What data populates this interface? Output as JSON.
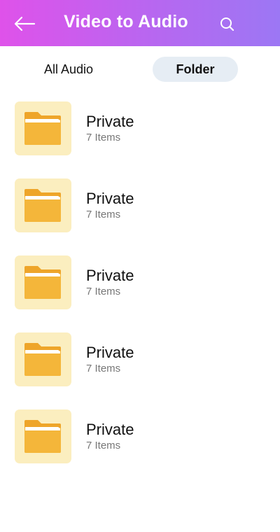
{
  "header": {
    "title": "Video to Audio",
    "back_icon": "arrow-left-icon",
    "search_icon": "search-icon",
    "gradient_start": "#df52ea",
    "gradient_end": "#9c77f4"
  },
  "tabs": [
    {
      "label": "All Audio",
      "active": false
    },
    {
      "label": "Folder",
      "active": true
    }
  ],
  "folders": [
    {
      "name": "Private",
      "count": "7 Items",
      "icon": "folder-icon"
    },
    {
      "name": "Private",
      "count": "7 Items",
      "icon": "folder-icon"
    },
    {
      "name": "Private",
      "count": "7 Items",
      "icon": "folder-icon"
    },
    {
      "name": "Private",
      "count": "7 Items",
      "icon": "folder-icon"
    },
    {
      "name": "Private",
      "count": "7 Items",
      "icon": "folder-icon"
    }
  ],
  "colors": {
    "folder_icon": "#f4b63a",
    "folder_bg": "#fbeebf",
    "active_tab_bg": "#e6edf4"
  }
}
